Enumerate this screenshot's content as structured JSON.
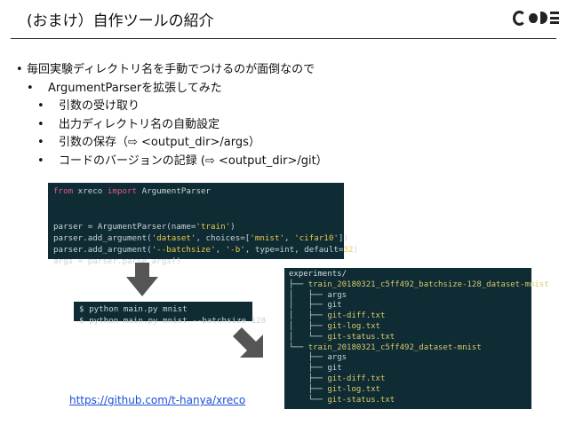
{
  "title": "(おまけ）自作ツールの紹介",
  "bullets": [
    "毎回実験ディレクトリ名を手動でつけるのが面倒なので",
    "ArgumentParserを拡張してみた",
    "引数の受け取り",
    "出力ディレクトリ名の自動設定",
    "引数の保存（⇨ <output_dir>/args）",
    "コードのバージョンの記録 (⇨ <output_dir>/git）"
  ],
  "bullet_symbol": "•",
  "code_parser": [
    [
      "kw",
      "from"
    ],
    [
      "t",
      " xreco "
    ],
    [
      "kw",
      "import"
    ],
    [
      "t",
      " ArgumentParser"
    ]
  ],
  "code_parser_lines": {
    "l1": "from xreco import ArgumentParser",
    "l2a": "parser = ArgumentParser(name=",
    "l2s": "'train'",
    "l2b": ")",
    "l3a": "parser.add_argument(",
    "l3s1": "'dataset'",
    "l3b": ", choices=[",
    "l3s2": "'mnist'",
    "l3c": ", ",
    "l3s3": "'cifar10'",
    "l3d": "])",
    "l4a": "parser.add_argument(",
    "l4s1": "'--batchsize'",
    "l4b": ", ",
    "l4s2": "'-b'",
    "l4c": ", type=int, default=",
    "l4n": "32",
    "l4d": ")",
    "l5": "args = parser.parse_args()"
  },
  "shell_lines": [
    "$ python main.py mnist",
    "$ python main.py mnist --batchsize 128"
  ],
  "tree": {
    "root": "experiments/",
    "dir1": "train_20180321_c5ff492_batchsize-128_dataset-mnist",
    "dir2": "train_20180321_c5ff492_dataset-mnist",
    "files": [
      "args",
      "git",
      "git-diff.txt",
      "git-log.txt",
      "git-status.txt"
    ]
  },
  "link": "https://github.com/t-hanya/xreco",
  "colors": {
    "code_bg": "#0f2b34",
    "keyword": "#e05a8c",
    "string": "#e7c94c",
    "link": "#1a4fd6"
  }
}
